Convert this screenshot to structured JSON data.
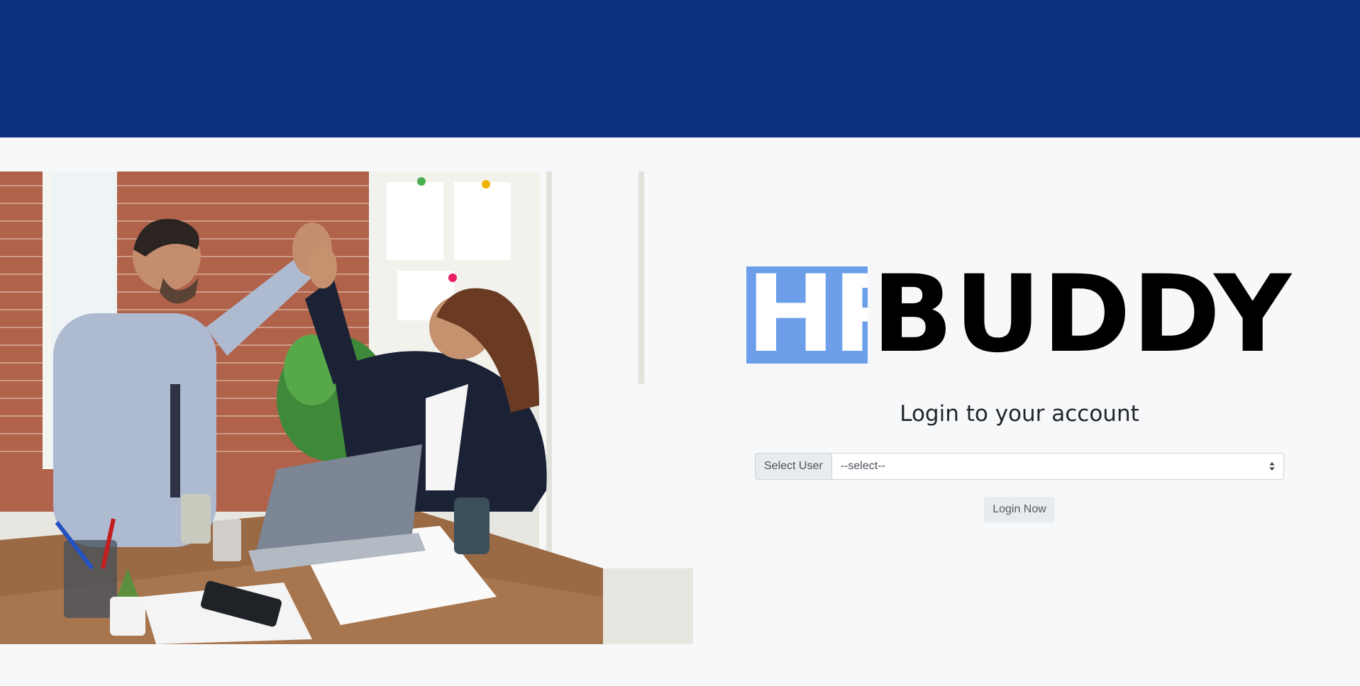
{
  "logo": {
    "part1": "HR",
    "part2": "BUDDY",
    "accent_color": "#6d9eea"
  },
  "header": {
    "color": "#0e3282"
  },
  "login": {
    "title": "Login to your account",
    "select_label": "Select User",
    "select_value": "--select--",
    "button_label": "Login Now"
  },
  "hero_image": {
    "description_icon": "office-photo"
  }
}
